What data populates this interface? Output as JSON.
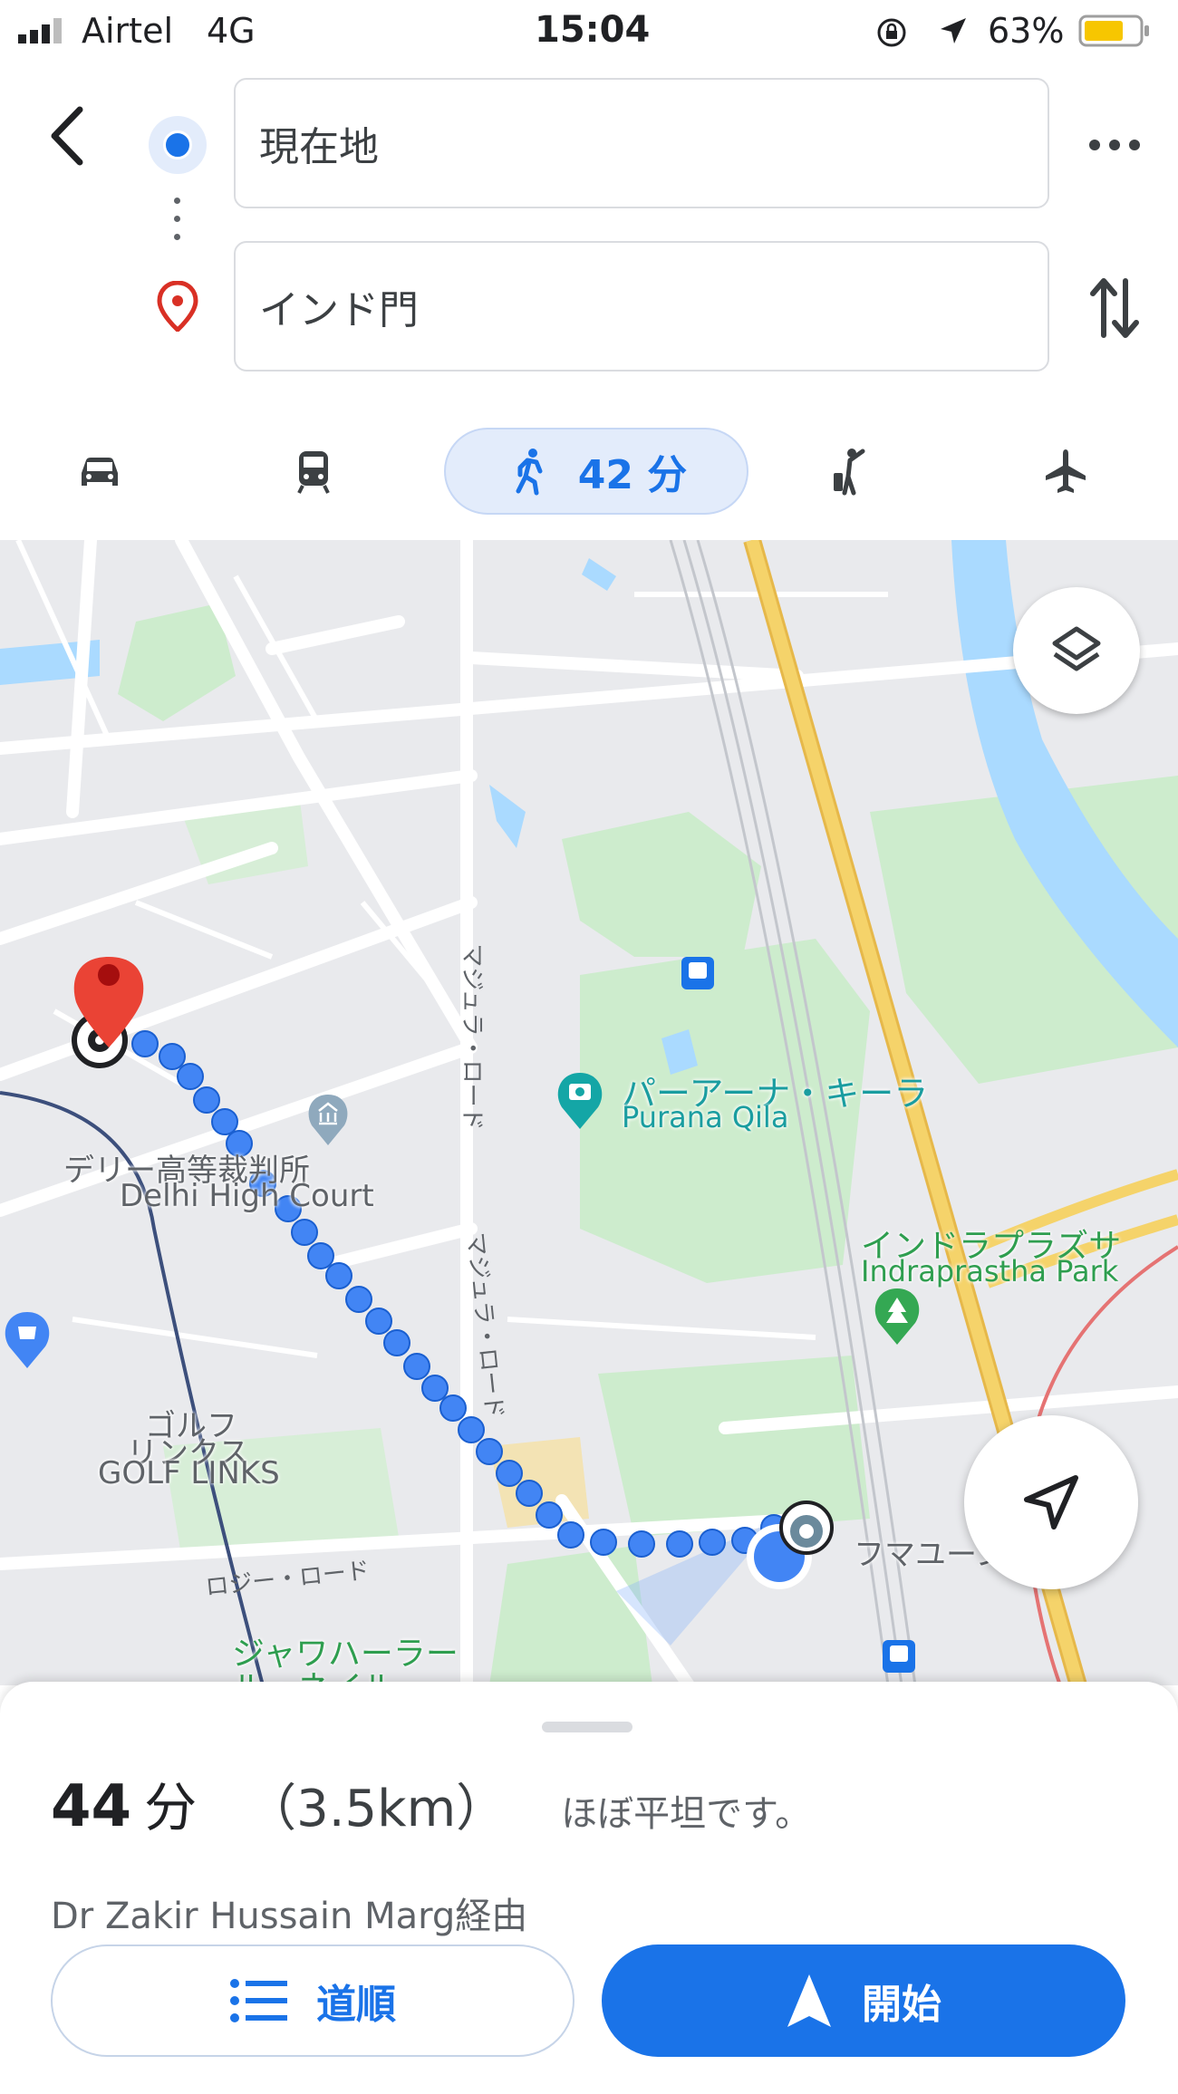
{
  "status_bar": {
    "carrier": "Airtel",
    "network": "4G",
    "time": "15:04",
    "battery_percent": "63%",
    "icons": [
      "signal-icon",
      "orientation-lock-icon",
      "location-arrow-icon",
      "battery-icon"
    ]
  },
  "search": {
    "origin_value": "現在地",
    "destination_value": "インド門",
    "icons": [
      "back-arrow-icon",
      "origin-dot-icon",
      "destination-pin-icon",
      "more-icon",
      "swap-icon"
    ]
  },
  "modes": [
    {
      "name": "car",
      "icon": "car-icon"
    },
    {
      "name": "transit",
      "icon": "train-icon"
    },
    {
      "name": "walk",
      "icon": "walk-icon",
      "label": "42 分",
      "selected": true
    },
    {
      "name": "ride",
      "icon": "ride-hail-icon"
    },
    {
      "name": "flight",
      "icon": "plane-icon"
    }
  ],
  "map": {
    "labels": {
      "delhi_high_court_jp": "デリー高等裁判所",
      "delhi_high_court_en": "Delhi High Court",
      "purana_qila_jp": "パーアーナ・キーラ",
      "purana_qila_en": "Purana Qila",
      "indraprastha_jp": "インドラプラズサ",
      "indraprastha_en": "Indraprastha Park",
      "golf_links_jp_1": "ゴルフ",
      "golf_links_jp_2": "リンクス",
      "golf_links_en": "GOLF LINKS",
      "humayun_jp": "フマユーン廟",
      "jawaharlal_jp_1": "ジャワハーラー",
      "jawaharlal_jp_2": "ル・ネイルー...",
      "mathura_road_1": "マジュラ・ロード",
      "mathura_road_2": "マジュラ・ロード",
      "lodhi_road": "ロジー・ロード"
    },
    "colors": {
      "route": "#4285f4",
      "park": "#cdeccd",
      "water": "#aadaff",
      "highway": "#f5d36a"
    }
  },
  "route": {
    "duration_number": "44",
    "duration_unit": "分",
    "distance": "（3.5km）",
    "terrain": "ほぼ平坦です。",
    "via": "Dr Zakir Hussain Marg経由"
  },
  "actions": {
    "steps_label": "道順",
    "start_label": "開始"
  }
}
